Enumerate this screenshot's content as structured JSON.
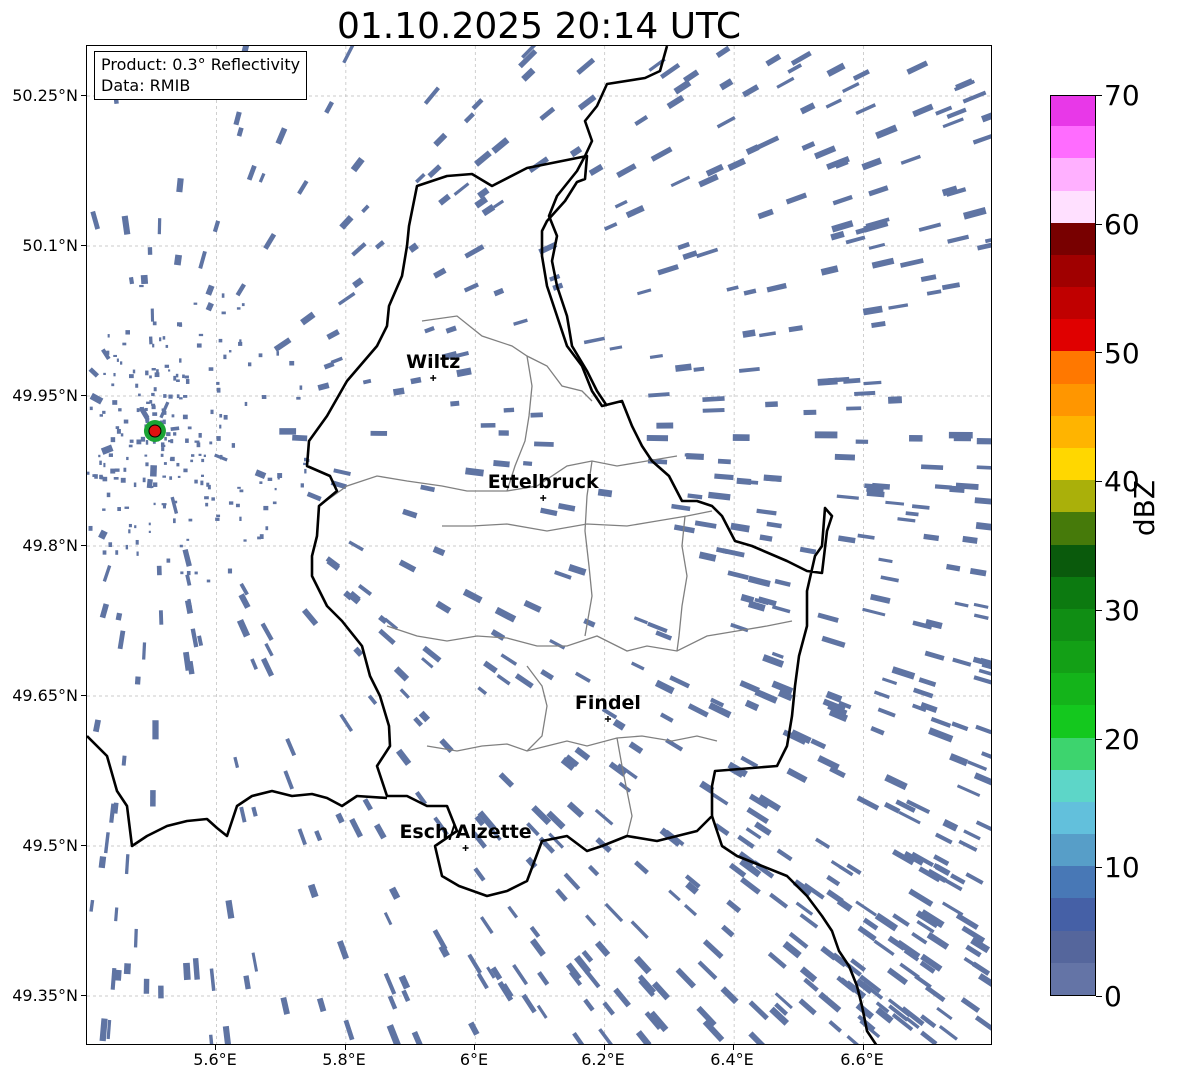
{
  "title": "01.10.2025 20:14 UTC",
  "info": {
    "product": "Product: 0.3° Reflectivity",
    "data": "Data: RMIB"
  },
  "axes": {
    "lat_labels": [
      "50.25°N",
      "50.1°N",
      "49.95°N",
      "49.8°N",
      "49.65°N",
      "49.5°N",
      "49.35°N"
    ],
    "lon_labels": [
      "5.6°E",
      "5.8°E",
      "6°E",
      "6.2°E",
      "6.4°E",
      "6.6°E"
    ],
    "lat_values": [
      50.25,
      50.1,
      49.95,
      49.8,
      49.65,
      49.5,
      49.35
    ],
    "lon_values": [
      5.6,
      5.8,
      6.0,
      6.2,
      6.4,
      6.6
    ],
    "lon_range": [
      5.4,
      6.8
    ],
    "lat_range": [
      49.3,
      50.3
    ]
  },
  "cities": [
    {
      "name": "Wiltz",
      "lon": 5.935,
      "lat": 49.968
    },
    {
      "name": "Ettelbruck",
      "lon": 6.105,
      "lat": 49.848
    },
    {
      "name": "Findel",
      "lon": 6.205,
      "lat": 49.627
    },
    {
      "name": "Esch/Alzette",
      "lon": 5.985,
      "lat": 49.498
    }
  ],
  "radar_site": {
    "lon": 5.505,
    "lat": 49.915,
    "color": "#e01010"
  },
  "colorbar": {
    "unit": "dBZ",
    "labels": [
      "70",
      "60",
      "50",
      "40",
      "30",
      "20",
      "10",
      "0"
    ],
    "min": 0,
    "max": 70,
    "step": 2.5,
    "colors": [
      "#6474a6",
      "#55669c",
      "#4560a6",
      "#4878b6",
      "#579ec8",
      "#62c0dc",
      "#5dd6c8",
      "#3dd46e",
      "#14c81e",
      "#14b41a",
      "#13a016",
      "#108e14",
      "#0c7a10",
      "#0a5a0c",
      "#467a0a",
      "#aab00a",
      "#ffd700",
      "#ffb400",
      "#ff9600",
      "#ff7800",
      "#e00000",
      "#c00000",
      "#a00000",
      "#780000",
      "#ffe0ff",
      "#ffb0ff",
      "#ff6cff",
      "#e838e8"
    ]
  },
  "echo_color": "#5f74a3",
  "border_color_national": "#000000",
  "border_color_cantonal": "#808080"
}
